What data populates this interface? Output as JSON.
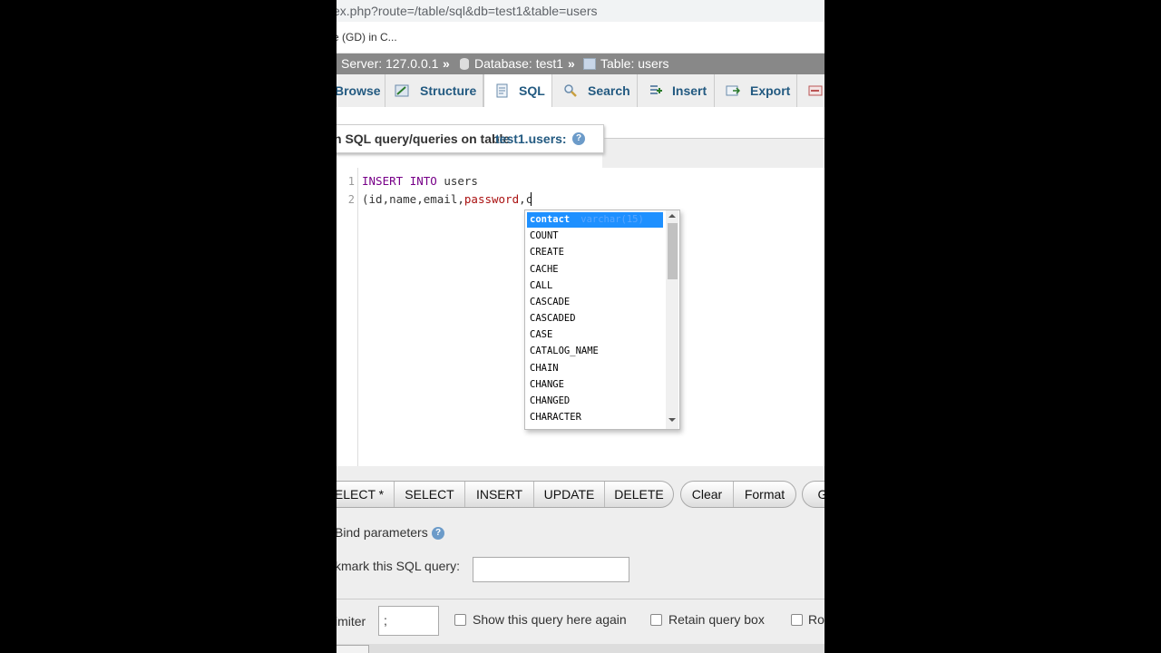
{
  "browser": {
    "url": "ex.php?route=/table/sql&db=test1&table=users",
    "bookmark_text": "e (GD) in C..."
  },
  "breadcrumb": {
    "server": "Server: 127.0.0.1",
    "separator": "»",
    "database": "Database: test1",
    "table": "Table: users"
  },
  "tabs": [
    {
      "label": "Browse",
      "icon": "browse-icon"
    },
    {
      "label": "Structure",
      "icon": "structure-icon"
    },
    {
      "label": "SQL",
      "icon": "sql-icon",
      "active": true
    },
    {
      "label": "Search",
      "icon": "search-icon"
    },
    {
      "label": "Insert",
      "icon": "insert-icon"
    },
    {
      "label": "Export",
      "icon": "export-icon"
    }
  ],
  "query_heading": {
    "text": "n SQL query/queries on table",
    "table_link": "test1.users:"
  },
  "editor": {
    "line_numbers": [
      "1",
      "2"
    ],
    "line1": {
      "kw1": "INSERT",
      "kw2": "INTO",
      "rest": " users"
    },
    "line2": {
      "prefix": "(id,name,email,",
      "password": "password",
      "suffix": ",c"
    }
  },
  "autocomplete": {
    "selected": {
      "label": "contact",
      "hint": "varchar(15)"
    },
    "items": [
      "COUNT",
      "CREATE",
      "CACHE",
      "CALL",
      "CASCADE",
      "CASCADED",
      "CASE",
      "CATALOG_NAME",
      "CHAIN",
      "CHANGE",
      "CHANGED",
      "CHARACTER"
    ]
  },
  "query_buttons": [
    "ELECT *",
    "SELECT",
    "INSERT",
    "UPDATE",
    "DELETE"
  ],
  "edit_buttons": [
    "Clear",
    "Format"
  ],
  "go_button_partial": "G",
  "bind_parameters": "Bind parameters",
  "bookmark_label": "kmark this SQL query:",
  "options": {
    "delimiter_label": "imiter",
    "delimiter_value": ";",
    "show_query_again": "Show this query here again",
    "retain_query_box": "Retain query box",
    "rollback_partial": "Ro"
  },
  "colors": {
    "link": "#235a81",
    "breadcrumb_bg": "#888888",
    "autocomplete_selected": "#1e90ff"
  }
}
